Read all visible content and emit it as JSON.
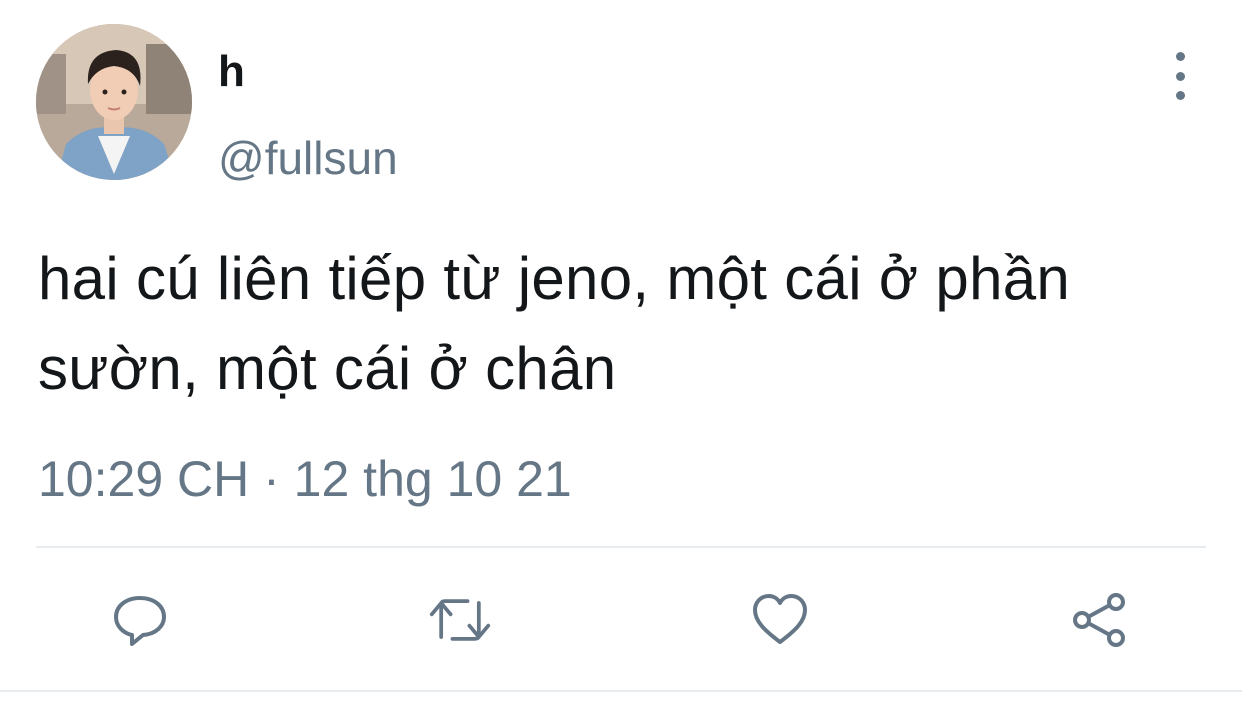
{
  "user": {
    "display_name": "h",
    "handle": "@fullsun"
  },
  "tweet": {
    "text": "hai cú liên tiếp từ jeno, một cái ở phần sườn, một cái ở chân",
    "timestamp": "10:29 CH · 12 thg 10 21"
  },
  "actions": {
    "reply_icon": "reply-icon",
    "retweet_icon": "retweet-icon",
    "like_icon": "heart-icon",
    "share_icon": "share-icon",
    "more_icon": "more-vertical-icon"
  },
  "colors": {
    "text": "#14171a",
    "secondary": "#657786",
    "divider": "#e6ecf0"
  }
}
